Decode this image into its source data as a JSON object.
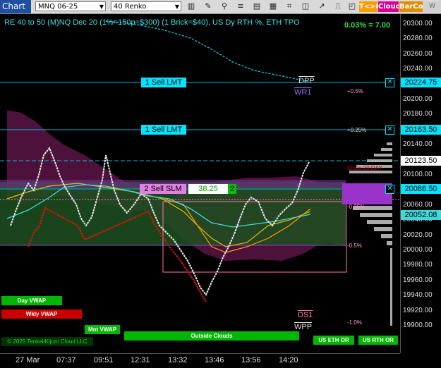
{
  "toolbar": {
    "title": "Chart",
    "symbol": "MNQ 06-25",
    "bar_type": "40 Renko",
    "btn_tk": "T<>K",
    "btn_cloud": "Cloud",
    "btn_barcol": "BarCol",
    "btn_w": "W VVVV"
  },
  "header": {
    "description": "RE 40 to 50 (M)NQ Dec 20 (1%=150p=$300) (1 Brick=$40), US Dy RTH %, ETH TPO",
    "change": "0.03% = 7.00"
  },
  "y_axis": [
    "20300.00",
    "20280.00",
    "20260.00",
    "20240.00",
    "20220.00",
    "20200.00",
    "20180.00",
    "20160.00",
    "20140.00",
    "20120.00",
    "20100.00",
    "20080.00",
    "20060.00",
    "20040.00",
    "20020.00",
    "20000.00",
    "19980.00",
    "19960.00",
    "19940.00",
    "19920.00",
    "19900.00"
  ],
  "price_tags": {
    "p1": "20224.75",
    "p2": "20163.50",
    "p3": "20123.50",
    "p4": "20086.50",
    "p5": "20052.08"
  },
  "x_axis": [
    "27 Mar",
    "07:37",
    "09:51",
    "12:31",
    "13:32",
    "13:46",
    "13:56",
    "14:20"
  ],
  "orders": {
    "sell1": "1 Sell LMT",
    "sell2": "1 Sell LMT",
    "sell3": "2 Sell SLM",
    "price": "38.25",
    "qty": "2"
  },
  "levels": {
    "dpp": "DPP",
    "wr1": "WR1",
    "ds1": "DS1",
    "wpp": "WPP",
    "p05": "+0.5%",
    "p025": "+0.25%",
    "m025": "-0.25%",
    "m05": "-0.5%",
    "m1": "-1.0%",
    "close": "Close 20 DAY"
  },
  "bars": {
    "day_vwap": "Day VWAP",
    "wkly_vwap": "Wkly VWAP",
    "mnt_vwap": "Mnt VWAP",
    "outside": "Outside Clouds",
    "us_eth": "US ETH OR",
    "us_rth": "US RTH OR",
    "copyright": "© 2025 Tenkei/Kijun/ Cloud LLC"
  },
  "colors": {
    "cyan": "#00e5ff",
    "green": "#00c000",
    "magenta": "#cc33cc",
    "red": "#cc0000",
    "orange": "#ff9900"
  }
}
